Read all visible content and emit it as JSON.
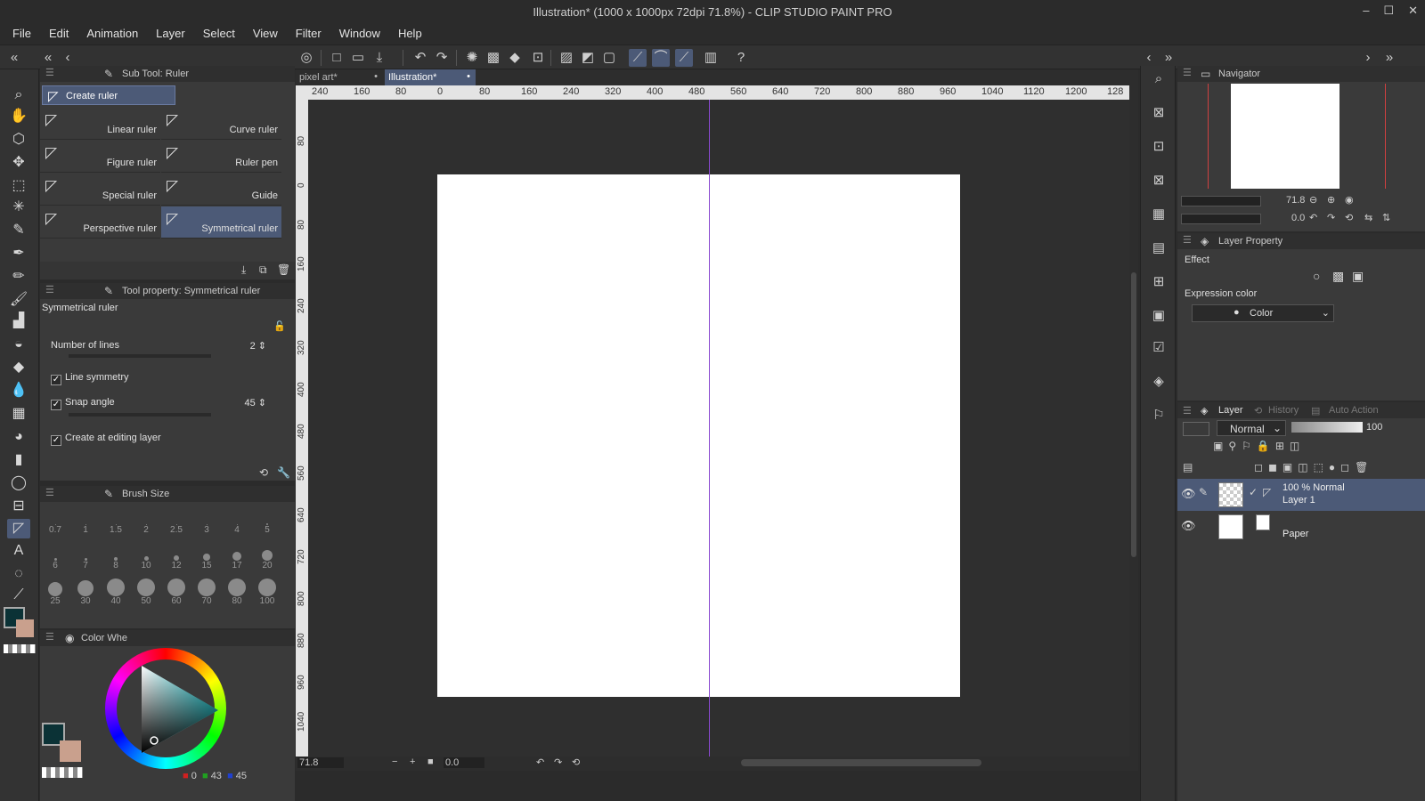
{
  "window": {
    "title": "Illustration* (1000 x 1000px 72dpi 71.8%)  - CLIP STUDIO PAINT PRO",
    "controls": [
      "‒",
      "☐",
      "✕"
    ]
  },
  "menu": [
    "File",
    "Edit",
    "Animation",
    "Layer",
    "Select",
    "View",
    "Filter",
    "Window",
    "Help"
  ],
  "subtool": {
    "header": "Sub Tool: Ruler",
    "create_ruler": "Create ruler",
    "items": [
      {
        "label": "Linear ruler"
      },
      {
        "label": "Curve ruler"
      },
      {
        "label": "Figure ruler"
      },
      {
        "label": "Ruler pen"
      },
      {
        "label": "Special ruler"
      },
      {
        "label": "Guide"
      },
      {
        "label": "Perspective ruler"
      },
      {
        "label": "Symmetrical ruler",
        "selected": true
      }
    ]
  },
  "tool_property": {
    "header": "Tool property: Symmetrical ruler",
    "title": "Symmetrical ruler",
    "number_of_lines_label": "Number of lines",
    "number_of_lines": "2",
    "line_symmetry_label": "Line symmetry",
    "line_symmetry_checked": true,
    "snap_angle_label": "Snap angle",
    "snap_angle_checked": true,
    "snap_angle": "45",
    "create_at_editing_layer_label": "Create at editing layer",
    "create_at_editing_layer_checked": true
  },
  "brush_size": {
    "header": "Brush Size",
    "sizes": [
      "0.7",
      "1",
      "1.5",
      "2",
      "2.5",
      "3",
      "4",
      "5",
      "6",
      "7",
      "8",
      "10",
      "12",
      "15",
      "17",
      "20",
      "25",
      "30",
      "40",
      "50",
      "60",
      "70",
      "80",
      "100"
    ]
  },
  "color_wheel": {
    "header": "Color Whe",
    "r": "0",
    "g": "43",
    "b": "45",
    "main_color": "#0b3236",
    "sub_color": "#c9a08d"
  },
  "canvas": {
    "tabs": [
      {
        "label": "pixel art*",
        "active": false
      },
      {
        "label": "Illustration*",
        "active": true
      }
    ],
    "h_ruler_ticks": [
      "240",
      "160",
      "80",
      "0",
      "80",
      "160",
      "240",
      "320",
      "400",
      "480",
      "560",
      "640",
      "720",
      "800",
      "880",
      "960",
      "1040",
      "1120",
      "1200",
      "128"
    ],
    "v_ruler_ticks": [
      "80",
      "0",
      "80",
      "160",
      "240",
      "320",
      "400",
      "480",
      "560",
      "640",
      "720",
      "800",
      "880",
      "960",
      "1040"
    ],
    "zoom": "71.8",
    "angle": "0.0",
    "symmetry_line_color": "#8a4ad0",
    "paper_color": "#ffffff"
  },
  "navigator": {
    "header": "Navigator",
    "zoom": "71.8",
    "angle": "0.0"
  },
  "layer_property": {
    "header": "Layer Property",
    "effect_label": "Effect",
    "expression_color_label": "Expression color",
    "expression_color_value": "Color"
  },
  "layers": {
    "tabs": [
      "Layer",
      "History",
      "Auto Action"
    ],
    "blend_mode": "Normal",
    "opacity": "100",
    "items": [
      {
        "line1": "100 % Normal",
        "line2": "Layer 1",
        "selected": true
      },
      {
        "line1": "",
        "line2": "Paper",
        "selected": false
      }
    ]
  },
  "colors": {
    "accent": "#4c5a77",
    "panel": "#3a3a3a",
    "background": "#2b2b2b"
  }
}
